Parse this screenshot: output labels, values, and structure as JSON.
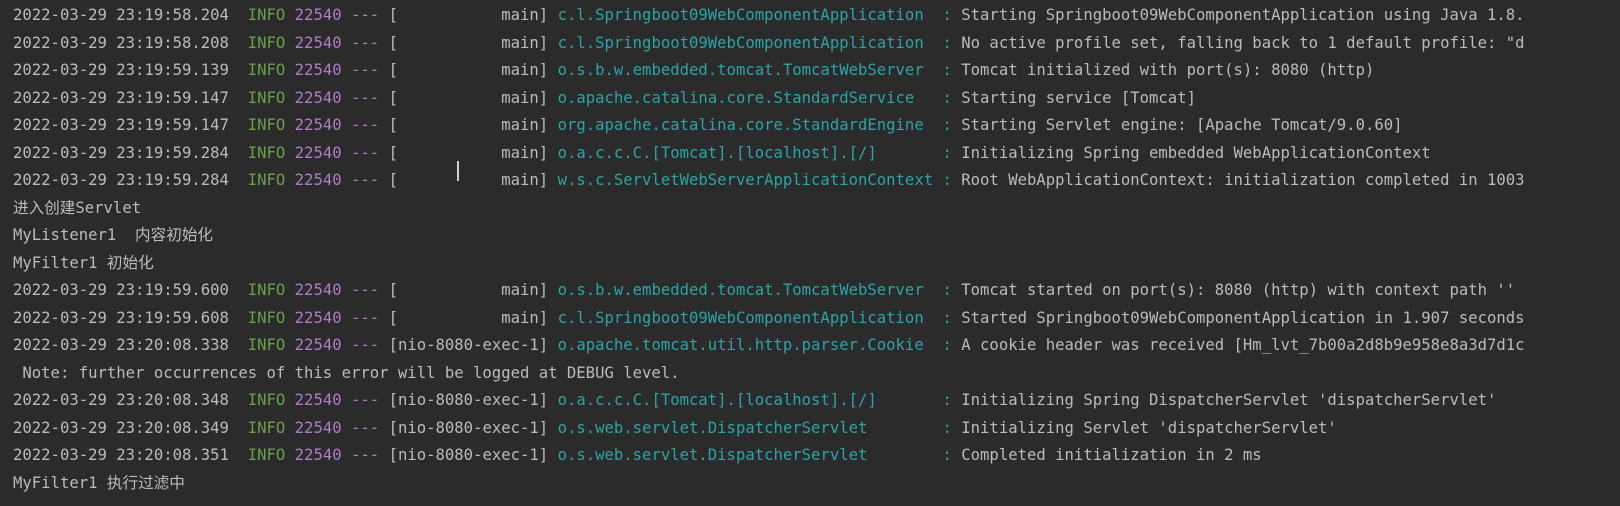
{
  "console": {
    "lines": [
      {
        "kind": "log",
        "ts": "2022-03-29 23:19:58.204",
        "level": "INFO",
        "pid": "22540",
        "thread": "main",
        "logger": "c.l.Springboot09WebComponentApplication",
        "message": "Starting Springboot09WebComponentApplication using Java 1.8."
      },
      {
        "kind": "log",
        "ts": "2022-03-29 23:19:58.208",
        "level": "INFO",
        "pid": "22540",
        "thread": "main",
        "logger": "c.l.Springboot09WebComponentApplication",
        "message": "No active profile set, falling back to 1 default profile: \"d"
      },
      {
        "kind": "log",
        "ts": "2022-03-29 23:19:59.139",
        "level": "INFO",
        "pid": "22540",
        "thread": "main",
        "logger": "o.s.b.w.embedded.tomcat.TomcatWebServer",
        "message": "Tomcat initialized with port(s): 8080 (http)"
      },
      {
        "kind": "log",
        "ts": "2022-03-29 23:19:59.147",
        "level": "INFO",
        "pid": "22540",
        "thread": "main",
        "logger": "o.apache.catalina.core.StandardService",
        "message": "Starting service [Tomcat]"
      },
      {
        "kind": "log",
        "ts": "2022-03-29 23:19:59.147",
        "level": "INFO",
        "pid": "22540",
        "thread": "main",
        "logger": "org.apache.catalina.core.StandardEngine",
        "message": "Starting Servlet engine: [Apache Tomcat/9.0.60]"
      },
      {
        "kind": "log",
        "ts": "2022-03-29 23:19:59.284",
        "level": "INFO",
        "pid": "22540",
        "thread": "main",
        "logger": "o.a.c.c.C.[Tomcat].[localhost].[/]",
        "message": "Initializing Spring embedded WebApplicationContext"
      },
      {
        "kind": "log",
        "ts": "2022-03-29 23:19:59.284",
        "level": "INFO",
        "pid": "22540",
        "thread": "main",
        "logger": "w.s.c.ServletWebServerApplicationContext",
        "message": "Root WebApplicationContext: initialization completed in 1003"
      },
      {
        "kind": "text",
        "text": "进入创建Servlet"
      },
      {
        "kind": "text",
        "text": "MyListener1  内容初始化"
      },
      {
        "kind": "text",
        "text": "MyFilter1 初始化"
      },
      {
        "kind": "log",
        "ts": "2022-03-29 23:19:59.600",
        "level": "INFO",
        "pid": "22540",
        "thread": "main",
        "logger": "o.s.b.w.embedded.tomcat.TomcatWebServer",
        "message": "Tomcat started on port(s): 8080 (http) with context path ''"
      },
      {
        "kind": "log",
        "ts": "2022-03-29 23:19:59.608",
        "level": "INFO",
        "pid": "22540",
        "thread": "main",
        "logger": "c.l.Springboot09WebComponentApplication",
        "message": "Started Springboot09WebComponentApplication in 1.907 seconds"
      },
      {
        "kind": "log",
        "ts": "2022-03-29 23:20:08.338",
        "level": "INFO",
        "pid": "22540",
        "thread": "nio-8080-exec-1",
        "logger": "o.apache.tomcat.util.http.parser.Cookie",
        "message": "A cookie header was received [Hm_lvt_7b00a2d8b9e958e8a3d7d1c"
      },
      {
        "kind": "text",
        "text": " Note: further occurrences of this error will be logged at DEBUG level."
      },
      {
        "kind": "log",
        "ts": "2022-03-29 23:20:08.348",
        "level": "INFO",
        "pid": "22540",
        "thread": "nio-8080-exec-1",
        "logger": "o.a.c.c.C.[Tomcat].[localhost].[/]",
        "message": "Initializing Spring DispatcherServlet 'dispatcherServlet'"
      },
      {
        "kind": "log",
        "ts": "2022-03-29 23:20:08.349",
        "level": "INFO",
        "pid": "22540",
        "thread": "nio-8080-exec-1",
        "logger": "o.s.web.servlet.DispatcherServlet",
        "message": "Initializing Servlet 'dispatcherServlet'"
      },
      {
        "kind": "log",
        "ts": "2022-03-29 23:20:08.351",
        "level": "INFO",
        "pid": "22540",
        "thread": "nio-8080-exec-1",
        "logger": "o.s.web.servlet.DispatcherServlet",
        "message": "Completed initialization in 2 ms"
      },
      {
        "kind": "text",
        "text": "MyFilter1 执行过滤中"
      }
    ]
  },
  "colors": {
    "background": "#2b2b2b",
    "text": "#bbbbbb",
    "level": "#6a9f4a",
    "pid": "#b07cc6",
    "logger": "#2aa5a5"
  }
}
